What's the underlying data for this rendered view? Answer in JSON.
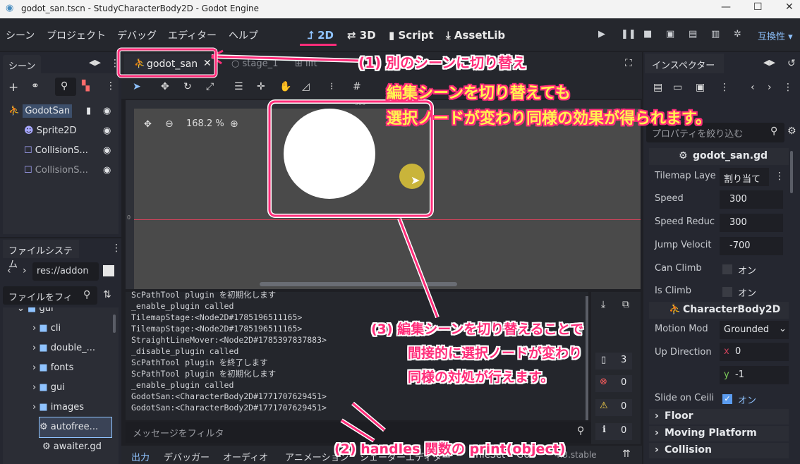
{
  "window": {
    "title": "godot_san.tscn - StudyCharacterBody2D - Godot Engine",
    "min": "—",
    "max": "☐",
    "close": "✕"
  },
  "menu": {
    "items": [
      "シーン",
      "プロジェクト",
      "デバッグ",
      "エディター",
      "ヘルプ"
    ]
  },
  "workspaces": [
    "2D",
    "3D",
    "Script",
    "AssetLib"
  ],
  "compat": "互換性",
  "scene_dock": {
    "title": "シーン",
    "nodes": [
      {
        "name": "GodotSan"
      },
      {
        "name": "Sprite2D"
      },
      {
        "name": "CollisionS..."
      },
      {
        "name": "CollisionS..."
      }
    ]
  },
  "fs_dock": {
    "title": "ファイルシステム",
    "path": "res://addon",
    "filter": "ファイルをフィ",
    "items": [
      {
        "name": "gui"
      },
      {
        "name": "cli"
      },
      {
        "name": "double_..."
      },
      {
        "name": "fonts"
      },
      {
        "name": "gui"
      },
      {
        "name": "images"
      },
      {
        "name": "autofree..."
      },
      {
        "name": "awaiter.gd"
      }
    ]
  },
  "tabs": [
    {
      "label": "godot_san"
    },
    {
      "label": "stage_1"
    },
    {
      "label": "lift"
    }
  ],
  "viewport": {
    "zoom": "168.2 %",
    "ruler_mark": "-500",
    "ruler_side": "0"
  },
  "output": {
    "lines": [
      "ScPathTool plugin を初期化します",
      "_enable_plugin called",
      "TilemapStage:<Node2D#1785196511165>",
      "TilemapStage:<Node2D#1785196511165>",
      "StraightLineMover:<Node2D#1785397837883>",
      "_disable_plugin called",
      "ScPathTool plugin を終了します",
      "ScPathTool plugin を初期化します",
      "_enable_plugin called",
      "GodotSan:<CharacterBody2D#1771707629451>",
      "GodotSan:<CharacterBody2D#1771707629451>"
    ],
    "filter_placeholder": "メッセージをフィルタ",
    "counts": {
      "log": "3",
      "error": "0",
      "warning": "0",
      "info": "0"
    }
  },
  "bottom_tabs": [
    "出力",
    "デバッガー",
    "オーディオ",
    "アニメーション",
    "シェーダーエディター",
    "TileSet",
    "GUT",
    "4.3.stable"
  ],
  "inspector": {
    "title": "インスペクター",
    "filter": "プロパティを絞り込む",
    "script": "godot_san.gd",
    "props": [
      {
        "label": "Tilemap Laye",
        "value": "割り当て"
      },
      {
        "label": "Speed",
        "value": "300"
      },
      {
        "label": "Speed Reduc",
        "value": "300"
      },
      {
        "label": "Jump Velocit",
        "value": "-700"
      },
      {
        "label": "Can Climb",
        "value": "オン"
      },
      {
        "label": "Is Climb",
        "value": "オン"
      }
    ],
    "section": "CharacterBody2D",
    "motion_mode": {
      "label": "Motion Mod",
      "value": "Grounded"
    },
    "up_direction": {
      "label": "Up Direction",
      "x": "0",
      "y": "-1",
      "x_lbl": "x",
      "y_lbl": "y"
    },
    "slide": {
      "label": "Slide on Ceili",
      "value": "オン"
    },
    "groups": [
      "Floor",
      "Moving Platform",
      "Collision"
    ]
  },
  "annotations": {
    "a1": "(1) 別のシーンに切り替え",
    "a2": "(2)  handles 関数の print(object)",
    "a3_l1": "(3)   編集シーンを切り替えることで",
    "a3_l2": "間接的に選択ノードが変わり",
    "a3_l3": "同様の対処が行えます。",
    "big_l1": "編集シーンを切り替えても",
    "big_l2": "選択ノードが変わり同様の効果が得られます。"
  },
  "colors": {
    "accent": "#8fc3ff",
    "annotation": "#ff2d7a",
    "highlight_text": "#fff44f",
    "circle": "#ffffff",
    "cursor_dot": "#c9b43a"
  }
}
